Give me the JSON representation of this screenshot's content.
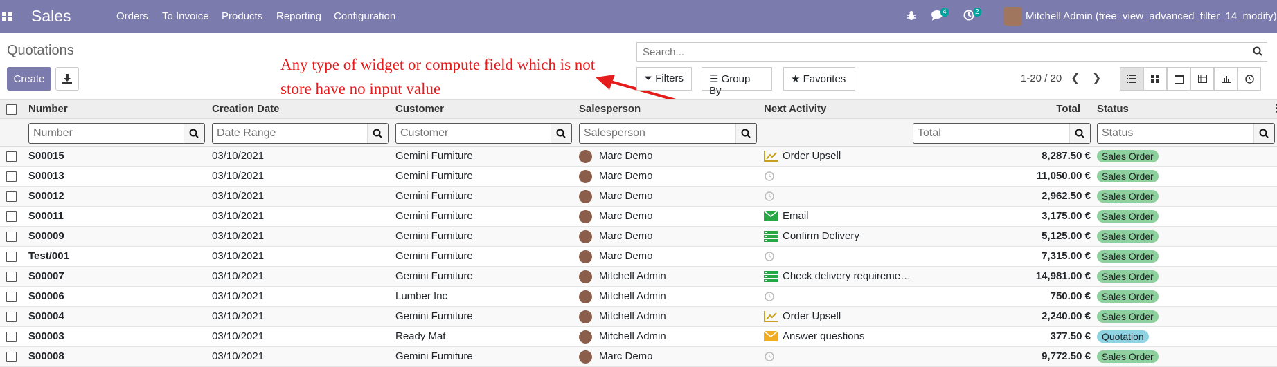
{
  "nav": {
    "brand": "Sales",
    "menu": [
      "Orders",
      "To Invoice",
      "Products",
      "Reporting",
      "Configuration"
    ],
    "messages_count": "4",
    "activities_count": "2",
    "user": "Mitchell Admin (tree_view_advanced_filter_14_modify)"
  },
  "page": {
    "title": "Quotations",
    "create_label": "Create",
    "annotation_line1": "Any type of widget or compute field which is not",
    "annotation_line2": "store have no input value"
  },
  "search": {
    "placeholder": "Search..."
  },
  "filters": {
    "filters_label": "Filters",
    "group_by_label": "Group By",
    "favorites_label": "Favorites"
  },
  "pager": {
    "value": "1-20 / 20"
  },
  "table": {
    "headers": {
      "number": "Number",
      "creation_date": "Creation Date",
      "customer": "Customer",
      "salesperson": "Salesperson",
      "next_activity": "Next Activity",
      "total": "Total",
      "status": "Status"
    },
    "filter_placeholders": {
      "number": "Number",
      "creation_date": "Date Range",
      "customer": "Customer",
      "salesperson": "Salesperson",
      "total": "Total",
      "status": "Status"
    },
    "rows": [
      {
        "number": "S00015",
        "date": "03/10/2021",
        "customer": "Gemini Furniture",
        "salesperson": "Marc Demo",
        "activity": "Order Upsell",
        "activity_icon": "upsell-chart-icon",
        "total": "8,287.50 €",
        "status": "Sales Order"
      },
      {
        "number": "S00013",
        "date": "03/10/2021",
        "customer": "Gemini Furniture",
        "salesperson": "Marc Demo",
        "activity": "",
        "activity_icon": "clock-icon",
        "total": "11,050.00 €",
        "status": "Sales Order"
      },
      {
        "number": "S00012",
        "date": "03/10/2021",
        "customer": "Gemini Furniture",
        "salesperson": "Marc Demo",
        "activity": "",
        "activity_icon": "clock-icon",
        "total": "2,962.50 €",
        "status": "Sales Order"
      },
      {
        "number": "S00011",
        "date": "03/10/2021",
        "customer": "Gemini Furniture",
        "salesperson": "Marc Demo",
        "activity": "Email",
        "activity_icon": "email-icon",
        "total": "3,175.00 €",
        "status": "Sales Order"
      },
      {
        "number": "S00009",
        "date": "03/10/2021",
        "customer": "Gemini Furniture",
        "salesperson": "Marc Demo",
        "activity": "Confirm Delivery",
        "activity_icon": "tasks-icon",
        "total": "5,125.00 €",
        "status": "Sales Order"
      },
      {
        "number": "Test/001",
        "date": "03/10/2021",
        "customer": "Gemini Furniture",
        "salesperson": "Marc Demo",
        "activity": "",
        "activity_icon": "clock-icon",
        "total": "7,315.00 €",
        "status": "Sales Order"
      },
      {
        "number": "S00007",
        "date": "03/10/2021",
        "customer": "Gemini Furniture",
        "salesperson": "Mitchell Admin",
        "activity": "Check delivery requireme…",
        "activity_icon": "tasks-icon",
        "total": "14,981.00 €",
        "status": "Sales Order"
      },
      {
        "number": "S00006",
        "date": "03/10/2021",
        "customer": "Lumber Inc",
        "salesperson": "Mitchell Admin",
        "activity": "",
        "activity_icon": "clock-icon",
        "total": "750.00 €",
        "status": "Sales Order"
      },
      {
        "number": "S00004",
        "date": "03/10/2021",
        "customer": "Gemini Furniture",
        "salesperson": "Mitchell Admin",
        "activity": "Order Upsell",
        "activity_icon": "upsell-chart-icon",
        "total": "2,240.00 €",
        "status": "Sales Order"
      },
      {
        "number": "S00003",
        "date": "03/10/2021",
        "customer": "Ready Mat",
        "salesperson": "Mitchell Admin",
        "activity": "Answer questions",
        "activity_icon": "email-icon",
        "total": "377.50 €",
        "status": "Quotation"
      },
      {
        "number": "S00008",
        "date": "03/10/2021",
        "customer": "Gemini Furniture",
        "salesperson": "Marc Demo",
        "activity": "",
        "activity_icon": "clock-icon",
        "total": "9,772.50 €",
        "status": "Sales Order"
      }
    ]
  },
  "colors": {
    "navbar": "#7c7bad",
    "annotation": "#e51c1c",
    "sales_order_badge": "#8fd19e",
    "quotation_badge": "#8fd3e3"
  }
}
